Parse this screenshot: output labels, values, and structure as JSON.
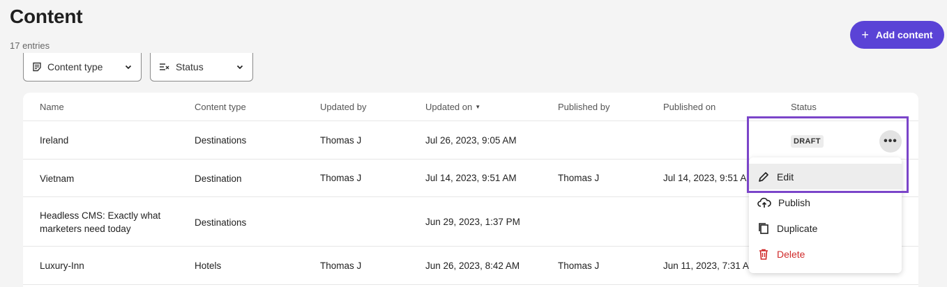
{
  "header": {
    "title": "Content",
    "entry_count": "17 entries",
    "add_button": "Add content"
  },
  "filters": {
    "content_type": "Content type",
    "status": "Status"
  },
  "table": {
    "columns": [
      "Name",
      "Content type",
      "Updated by",
      "Updated on",
      "Published by",
      "Published on",
      "Status"
    ],
    "rows": [
      {
        "name": "Ireland",
        "content_type": "Destinations",
        "updated_by": "Thomas J",
        "updated_on": "Jul 26, 2023, 9:05 AM",
        "published_by": "",
        "published_on": "",
        "status": "DRAFT"
      },
      {
        "name": "Vietnam",
        "content_type": "Destination",
        "updated_by": "Thomas J",
        "updated_on": "Jul 14, 2023, 9:51 AM",
        "published_by": "Thomas J",
        "published_on": "Jul 14, 2023, 9:51 A",
        "status": ""
      },
      {
        "name": "Headless CMS: Exactly what marketers need today",
        "content_type": "Destinations",
        "updated_by": "",
        "updated_on": "Jun 29, 2023, 1:37 PM",
        "published_by": "",
        "published_on": "",
        "status": ""
      },
      {
        "name": "Luxury-Inn",
        "content_type": "Hotels",
        "updated_by": "Thomas J",
        "updated_on": "Jun 26, 2023, 8:42 AM",
        "published_by": "Thomas J",
        "published_on": "Jun 11, 2023, 7:31 A",
        "status": ""
      }
    ]
  },
  "row_actions": {
    "more": "•••",
    "menu": [
      {
        "label": "Edit",
        "icon": "pencil-icon"
      },
      {
        "label": "Publish",
        "icon": "cloud-upload-icon"
      },
      {
        "label": "Duplicate",
        "icon": "copy-icon"
      },
      {
        "label": "Delete",
        "icon": "trash-icon"
      }
    ]
  },
  "colors": {
    "accent": "#5a43d6",
    "highlight": "#7b45c9",
    "danger": "#d02b2b"
  }
}
